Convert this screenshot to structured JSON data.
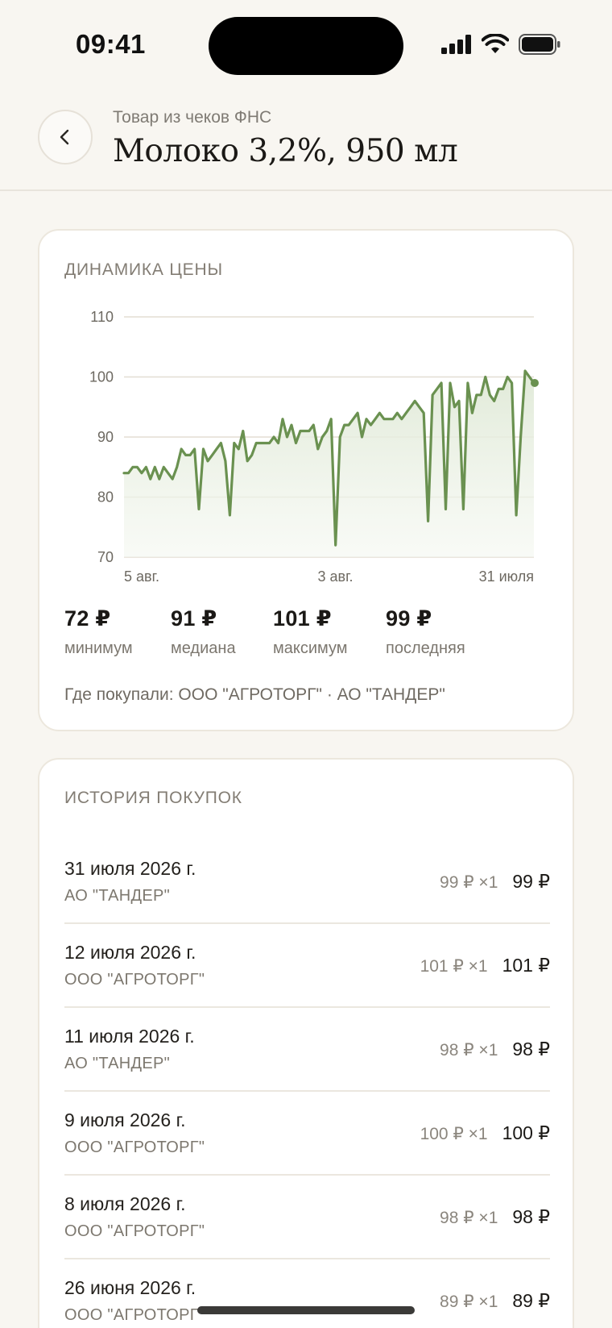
{
  "status_bar": {
    "time": "09:41"
  },
  "header": {
    "subtitle": "Товар из чеков ФНС",
    "title": "Молоко 3,2%, 950 мл"
  },
  "price_card": {
    "section_title": "ДИНАМИКА ЦЕНЫ",
    "stats": [
      {
        "value": "72 ₽",
        "label": "минимум"
      },
      {
        "value": "91 ₽",
        "label": "медиана"
      },
      {
        "value": "101 ₽",
        "label": "максимум"
      },
      {
        "value": "99 ₽",
        "label": "последняя"
      }
    ],
    "shops": "Где покупали: ООО \"АГРОТОРГ\" · АО \"ТАНДЕР\""
  },
  "chart_data": {
    "type": "area",
    "title": "",
    "xlabel": "",
    "ylabel": "",
    "ylim": [
      70,
      110
    ],
    "y_ticks": [
      "110",
      "100",
      "90",
      "80",
      "70"
    ],
    "x_tick_labels": [
      "5 авг.",
      "3 авг.",
      "31 июля"
    ],
    "grid": true,
    "line_color": "#6a9150",
    "fill_color": "#e7efe1",
    "values": [
      84,
      84,
      85,
      85,
      84,
      85,
      83,
      85,
      83,
      85,
      84,
      83,
      85,
      88,
      87,
      87,
      88,
      78,
      88,
      86,
      87,
      88,
      89,
      86,
      77,
      89,
      88,
      91,
      86,
      87,
      89,
      89,
      89,
      89,
      90,
      89,
      93,
      90,
      92,
      89,
      91,
      91,
      91,
      92,
      88,
      90,
      91,
      93,
      72,
      90,
      92,
      92,
      93,
      94,
      90,
      93,
      92,
      93,
      94,
      93,
      93,
      93,
      94,
      93,
      94,
      95,
      96,
      95,
      94,
      76,
      97,
      98,
      99,
      78,
      99,
      95,
      96,
      78,
      99,
      94,
      97,
      97,
      100,
      97,
      96,
      98,
      98,
      100,
      99,
      77,
      90,
      101,
      100,
      99
    ],
    "last_value": 99
  },
  "history": {
    "section_title": "ИСТОРИЯ ПОКУПОК",
    "rows": [
      {
        "date": "31 июля 2026 г.",
        "shop": "АО \"ТАНДЕР\"",
        "qty": "99 ₽ ×1",
        "sum": "99 ₽"
      },
      {
        "date": "12 июля 2026 г.",
        "shop": "ООО \"АГРОТОРГ\"",
        "qty": "101 ₽ ×1",
        "sum": "101 ₽"
      },
      {
        "date": "11 июля 2026 г.",
        "shop": "АО \"ТАНДЕР\"",
        "qty": "98 ₽ ×1",
        "sum": "98 ₽"
      },
      {
        "date": "9 июля 2026 г.",
        "shop": "ООО \"АГРОТОРГ\"",
        "qty": "100 ₽ ×1",
        "sum": "100 ₽"
      },
      {
        "date": "8 июля 2026 г.",
        "shop": "ООО \"АГРОТОРГ\"",
        "qty": "98 ₽ ×1",
        "sum": "98 ₽"
      },
      {
        "date": "26 июня 2026 г.",
        "shop": "ООО \"АГРОТОРГ\"",
        "qty": "89 ₽ ×1",
        "sum": "89 ₽"
      }
    ]
  },
  "icons": {
    "back": "chevron-left-icon",
    "signal": "cellular-signal-icon",
    "wifi": "wifi-icon",
    "battery": "battery-icon"
  }
}
